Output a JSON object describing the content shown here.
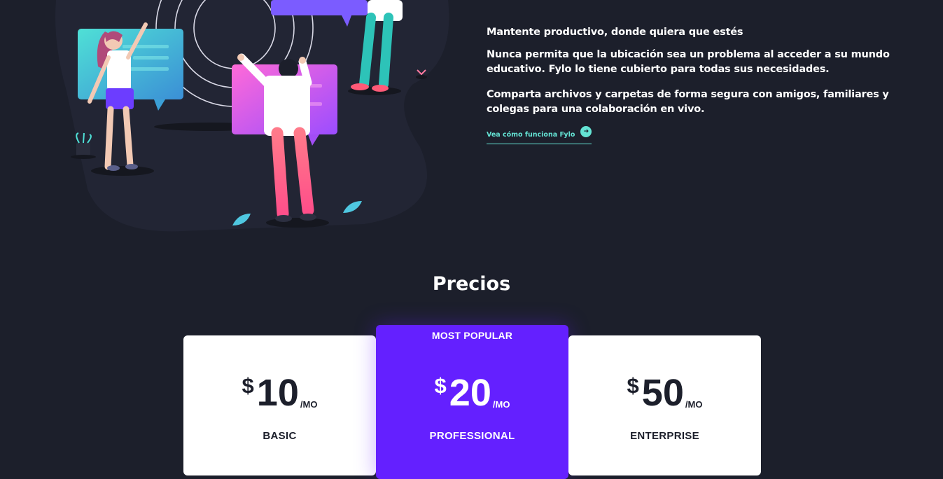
{
  "info": {
    "heading": "Mantente productivo, donde quiera que estés",
    "paragraph1": "Nunca permita que la ubicación sea un problema al acceder a su mundo educativo. Fylo lo tiene cubierto para todas sus necesidades.",
    "paragraph2": "Comparta archivos y carpetas de forma segura con amigos, familiares y colegas para una colaboración en vivo.",
    "link_label": "Vea cómo funciona Fylo",
    "link_icon": "arrow-right-icon"
  },
  "pricing": {
    "title": "Precios",
    "plans": [
      {
        "currency": "$",
        "amount": "10",
        "period": "/MO",
        "name": "BASIC"
      },
      {
        "badge": "MOST POPULAR",
        "currency": "$",
        "amount": "20",
        "period": "/MO",
        "name": "PROFESSIONAL"
      },
      {
        "currency": "$",
        "amount": "50",
        "period": "/MO",
        "name": "ENTERPRISE"
      }
    ]
  },
  "colors": {
    "background": "#1c1f2b",
    "accent_cyan": "#64e3d4",
    "accent_purple": "#6420ff",
    "card": "#ffffff"
  }
}
